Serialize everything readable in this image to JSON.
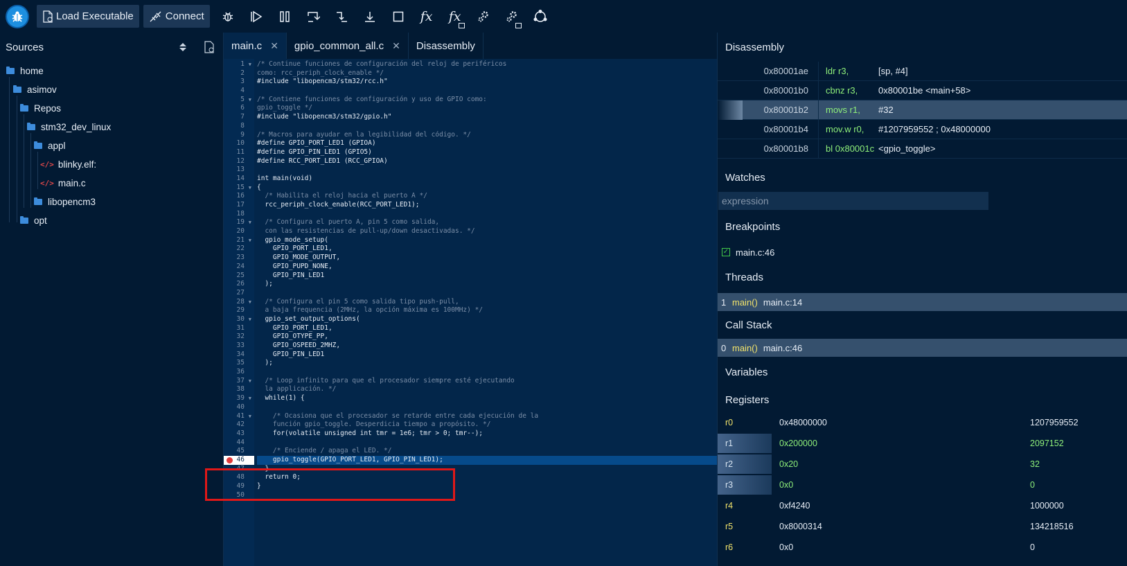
{
  "toolbar": {
    "load_label": "Load Executable",
    "connect_label": "Connect",
    "fx1": "fx",
    "fx2": "fx"
  },
  "sources": {
    "title": "Sources",
    "tree": [
      "home",
      "asimov",
      "Repos",
      "stm32_dev_linux",
      "appl",
      "blinky.elf:",
      "main.c",
      "libopencm3",
      "opt"
    ]
  },
  "editor": {
    "tabs": [
      "main.c",
      "gpio_common_all.c",
      "Disassembly"
    ],
    "close": "✕",
    "breakpoint_line": 46,
    "current_line": 46,
    "lines": [
      "/* Continue funciones de configuración del reloj de periféricos",
      "como: rcc_periph_clock_enable */",
      "#include \"libopencm3/stm32/rcc.h\"",
      "",
      "/* Contiene funciones de configuración y uso de GPIO como:",
      "gpio_toggle */",
      "#include \"libopencm3/stm32/gpio.h\"",
      "",
      "/* Macros para ayudar en la legibilidad del código. */",
      "#define GPIO_PORT_LED1 (GPIOA)",
      "#define GPIO_PIN_LED1 (GPIO5)",
      "#define RCC_PORT_LED1 (RCC_GPIOA)",
      "",
      "int main(void)",
      "{",
      "  /* Habilita el reloj hacia el puerto A */",
      "  rcc_periph_clock_enable(RCC_PORT_LED1);",
      "",
      "  /* Configura el puerto A, pin 5 como salida,",
      "  con las resistencias de pull-up/down desactivadas. */",
      "  gpio_mode_setup(",
      "    GPIO_PORT_LED1,",
      "    GPIO_MODE_OUTPUT,",
      "    GPIO_PUPD_NONE,",
      "    GPIO_PIN_LED1",
      "  );",
      "",
      "  /* Configura el pin 5 como salida tipo push-pull,",
      "  a baja frequencia (2MHz, la opción máxima es 100MHz) */",
      "  gpio_set_output_options(",
      "    GPIO_PORT_LED1,",
      "    GPIO_OTYPE_PP,",
      "    GPIO_OSPEED_2MHZ,",
      "    GPIO_PIN_LED1",
      "  );",
      "",
      "  /* Loop infinito para que el procesador siempre esté ejecutando",
      "  la applicación. */",
      "  while(1) {",
      "",
      "    /* Ocasiona que el procesador se retarde entre cada ejecución de la",
      "    función gpio_toggle. Desperdicia tiempo a propósito. */",
      "    for(volatile unsigned int tmr = 1e6; tmr > 0; tmr--);",
      "",
      "    /* Enciende / apaga el LED. */",
      "    gpio_toggle(GPIO_PORT_LED1, GPIO_PIN_LED1);",
      "  }",
      "  return 0;",
      "}",
      ""
    ],
    "fold_lines": [
      1,
      5,
      15,
      19,
      21,
      28,
      30,
      37,
      39,
      41
    ]
  },
  "disassembly": {
    "title": "Disassembly",
    "rows": [
      {
        "addr": "0x80001ae",
        "ins": "ldr r3,",
        "ops": "[sp, #4]"
      },
      {
        "addr": "0x80001b0",
        "ins": "cbnz r3,",
        "ops": "0x80001be <main+58>"
      },
      {
        "addr": "0x80001b2",
        "ins": "movs r1,",
        "ops": "#32",
        "current": true
      },
      {
        "addr": "0x80001b4",
        "ins": "mov.w r0,",
        "ops": "#1207959552 ; 0x48000000"
      },
      {
        "addr": "0x80001b8",
        "ins": "bl 0x80001c",
        "ops": "<gpio_toggle>"
      }
    ]
  },
  "watches": {
    "title": "Watches",
    "placeholder": "expression"
  },
  "breakpoints": {
    "title": "Breakpoints",
    "items": [
      "main.c:46"
    ]
  },
  "threads": {
    "title": "Threads",
    "items": [
      {
        "id": "1",
        "fn": "main()",
        "loc": "main.c:14"
      }
    ]
  },
  "callstack": {
    "title": "Call Stack",
    "items": [
      {
        "id": "0",
        "fn": "main()",
        "loc": "main.c:46"
      }
    ]
  },
  "variables": {
    "title": "Variables"
  },
  "registers": {
    "title": "Registers",
    "rows": [
      {
        "name": "r0",
        "hex": "0x48000000",
        "dec": "1207959552",
        "changed": false
      },
      {
        "name": "r1",
        "hex": "0x200000",
        "dec": "2097152",
        "changed": true
      },
      {
        "name": "r2",
        "hex": "0x20",
        "dec": "32",
        "changed": true
      },
      {
        "name": "r3",
        "hex": "0x0",
        "dec": "0",
        "changed": true
      },
      {
        "name": "r4",
        "hex": "0xf4240",
        "dec": "1000000",
        "changed": false
      },
      {
        "name": "r5",
        "hex": "0x8000314",
        "dec": "134218516",
        "changed": false
      },
      {
        "name": "r6",
        "hex": "0x0",
        "dec": "0",
        "changed": false
      }
    ]
  },
  "colors": {
    "background": "#03264a",
    "panel": "#021a33",
    "breakpoint": "#e03a3a",
    "instr": "#8ff07a",
    "fn": "#f2e36b"
  }
}
